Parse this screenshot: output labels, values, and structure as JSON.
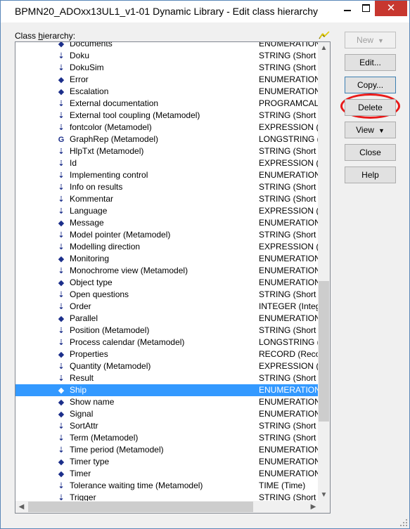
{
  "window": {
    "title": "BPMN20_ADOxx13UL1_v1-01 Dynamic Library - Edit class hierarchy",
    "minimize_glyph": "",
    "maximize_glyph": "",
    "close_glyph": "✕"
  },
  "hierarchy": {
    "label_prefix": "Class ",
    "label_underlined": "h",
    "label_suffix": "ierarchy:",
    "rows": [
      {
        "name": "Documents",
        "type": "ENUMERATION",
        "icon": "diamond-icon",
        "glyph": "◆",
        "selected": false
      },
      {
        "name": "Doku",
        "type": "STRING (Short s",
        "icon": "attribute-arrow-icon",
        "glyph": "⇣",
        "selected": false
      },
      {
        "name": "DokuSim",
        "type": "STRING (Short s",
        "icon": "attribute-arrow-icon",
        "glyph": "⇣",
        "selected": false
      },
      {
        "name": "Error",
        "type": "ENUMERATION",
        "icon": "diamond-icon",
        "glyph": "◆",
        "selected": false
      },
      {
        "name": "Escalation",
        "type": "ENUMERATION",
        "icon": "diamond-icon",
        "glyph": "◆",
        "selected": false
      },
      {
        "name": "External documentation",
        "type": "PROGRAMCALL",
        "icon": "attribute-arrow-icon",
        "glyph": "⇣",
        "selected": false
      },
      {
        "name": "External tool coupling (Metamodel)",
        "type": "STRING (Short s",
        "icon": "attribute-arrow-icon",
        "glyph": "⇣",
        "selected": false
      },
      {
        "name": "fontcolor (Metamodel)",
        "type": "EXPRESSION (Ex",
        "icon": "attribute-arrow-icon",
        "glyph": "⇣",
        "selected": false
      },
      {
        "name": "GraphRep (Metamodel)",
        "type": "LONGSTRING (L",
        "icon": "graphrep-icon",
        "glyph": "G",
        "selected": false
      },
      {
        "name": "HlpTxt (Metamodel)",
        "type": "STRING (Short s",
        "icon": "attribute-arrow-icon",
        "glyph": "⇣",
        "selected": false
      },
      {
        "name": "Id",
        "type": "EXPRESSION (Ex",
        "icon": "attribute-arrow-icon",
        "glyph": "⇣",
        "selected": false
      },
      {
        "name": "Implementing control",
        "type": "ENUMERATION",
        "icon": "attribute-arrow-icon",
        "glyph": "⇣",
        "selected": false
      },
      {
        "name": "Info on results",
        "type": "STRING (Short s",
        "icon": "attribute-arrow-icon",
        "glyph": "⇣",
        "selected": false
      },
      {
        "name": "Kommentar",
        "type": "STRING (Short s",
        "icon": "attribute-arrow-icon",
        "glyph": "⇣",
        "selected": false
      },
      {
        "name": "Language",
        "type": "EXPRESSION (Ex",
        "icon": "attribute-arrow-icon",
        "glyph": "⇣",
        "selected": false
      },
      {
        "name": "Message",
        "type": "ENUMERATION",
        "icon": "diamond-icon",
        "glyph": "◆",
        "selected": false
      },
      {
        "name": "Model pointer (Metamodel)",
        "type": "STRING (Short s",
        "icon": "attribute-arrow-icon",
        "glyph": "⇣",
        "selected": false
      },
      {
        "name": "Modelling direction",
        "type": "EXPRESSION (Ex",
        "icon": "attribute-arrow-icon",
        "glyph": "⇣",
        "selected": false
      },
      {
        "name": "Monitoring",
        "type": "ENUMERATION",
        "icon": "diamond-icon",
        "glyph": "◆",
        "selected": false
      },
      {
        "name": "Monochrome view (Metamodel)",
        "type": "ENUMERATION",
        "icon": "attribute-arrow-icon",
        "glyph": "⇣",
        "selected": false
      },
      {
        "name": "Object type",
        "type": "ENUMERATION",
        "icon": "diamond-icon",
        "glyph": "◆",
        "selected": false
      },
      {
        "name": "Open questions",
        "type": "STRING (Short s",
        "icon": "attribute-arrow-icon",
        "glyph": "⇣",
        "selected": false
      },
      {
        "name": "Order",
        "type": "INTEGER (Intege",
        "icon": "attribute-arrow-icon",
        "glyph": "⇣",
        "selected": false
      },
      {
        "name": "Parallel",
        "type": "ENUMERATION",
        "icon": "diamond-icon",
        "glyph": "◆",
        "selected": false
      },
      {
        "name": "Position (Metamodel)",
        "type": "STRING (Short s",
        "icon": "attribute-arrow-icon",
        "glyph": "⇣",
        "selected": false
      },
      {
        "name": "Process calendar (Metamodel)",
        "type": "LONGSTRING (L",
        "icon": "attribute-arrow-icon",
        "glyph": "⇣",
        "selected": false
      },
      {
        "name": "Properties",
        "type": "RECORD (Recor",
        "icon": "diamond-icon",
        "glyph": "◆",
        "selected": false
      },
      {
        "name": "Quantity (Metamodel)",
        "type": "EXPRESSION (Ex",
        "icon": "attribute-arrow-icon",
        "glyph": "⇣",
        "selected": false
      },
      {
        "name": "Result",
        "type": "STRING (Short s",
        "icon": "attribute-arrow-icon",
        "glyph": "⇣",
        "selected": false
      },
      {
        "name": "Ship",
        "type": "ENUMERATION",
        "icon": "diamond-icon",
        "glyph": "◆",
        "selected": true
      },
      {
        "name": "Show name",
        "type": "ENUMERATION",
        "icon": "diamond-icon",
        "glyph": "◆",
        "selected": false
      },
      {
        "name": "Signal",
        "type": "ENUMERATION",
        "icon": "diamond-icon",
        "glyph": "◆",
        "selected": false
      },
      {
        "name": "SortAttr",
        "type": "STRING (Short s",
        "icon": "attribute-arrow-icon",
        "glyph": "⇣",
        "selected": false
      },
      {
        "name": "Term (Metamodel)",
        "type": "STRING (Short s",
        "icon": "attribute-arrow-icon",
        "glyph": "⇣",
        "selected": false
      },
      {
        "name": "Time period (Metamodel)",
        "type": "ENUMERATION",
        "icon": "attribute-arrow-icon",
        "glyph": "⇣",
        "selected": false
      },
      {
        "name": "Timer type",
        "type": "ENUMERATION",
        "icon": "diamond-icon",
        "glyph": "◆",
        "selected": false
      },
      {
        "name": "Timer",
        "type": "ENUMERATION",
        "icon": "diamond-icon",
        "glyph": "◆",
        "selected": false
      },
      {
        "name": "Tolerance waiting time (Metamodel)",
        "type": "TIME (Time)",
        "icon": "attribute-arrow-icon",
        "glyph": "⇣",
        "selected": false
      },
      {
        "name": "Trigger",
        "type": "STRING (Short s",
        "icon": "attribute-arrow-icon",
        "glyph": "⇣",
        "selected": false
      }
    ]
  },
  "buttons": {
    "new": "New",
    "edit": "Edit...",
    "copy": "Copy...",
    "delete": "Delete",
    "view": "View",
    "close": "Close",
    "help": "Help"
  },
  "scroll": {
    "up": "▲",
    "down": "▼",
    "left": "◀",
    "right": "▶"
  },
  "colors": {
    "selection": "#3399ff",
    "annotation_circle": "#e81919",
    "icon_blue": "#1b2e8a"
  }
}
